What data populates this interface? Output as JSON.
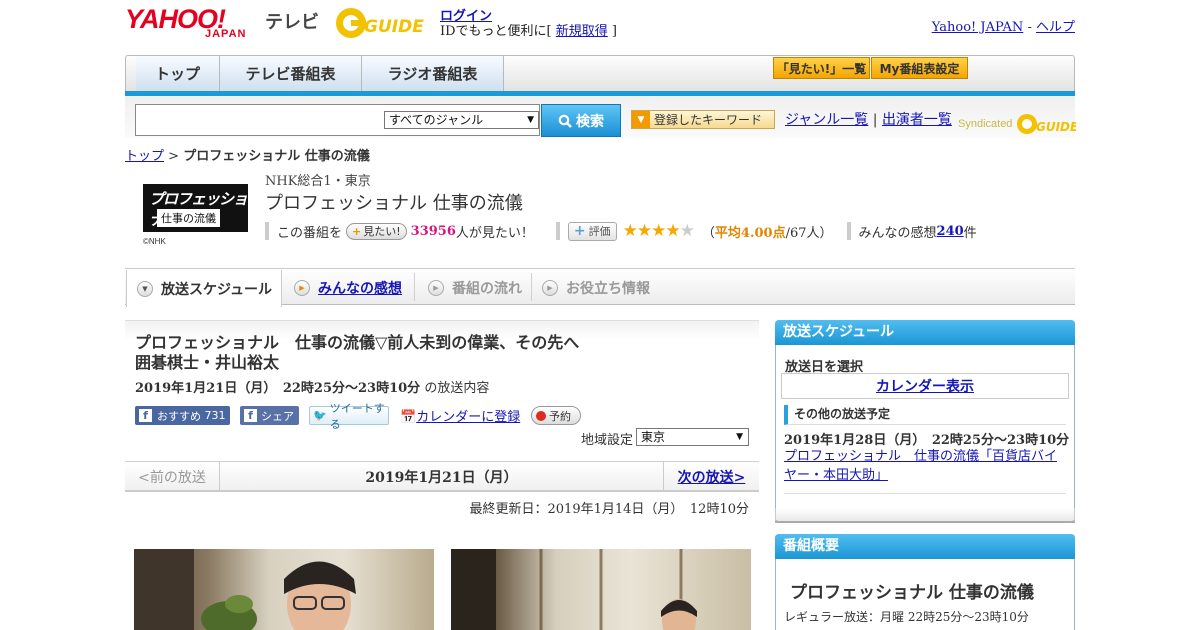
{
  "header": {
    "logo_yahoo": "YAHOO!",
    "logo_japan": "JAPAN",
    "logo_tv": "テレビ",
    "logo_gguide": "GUIDE",
    "login_link": "ログイン",
    "login_prefix": "IDでもっと便利に[ ",
    "register_link": "新規取得",
    "login_suffix": " ]",
    "yahoo_japan_link": "Yahoo! JAPAN",
    "sep": " - ",
    "help_link": "ヘルプ"
  },
  "nav": {
    "tabs": [
      "トップ",
      "テレビ番組表",
      "ラジオ番組表"
    ],
    "want_list": "「見たい!」一覧",
    "my_schedule": "My番組表設定"
  },
  "search": {
    "genre": "すべてのジャンル",
    "button": "検索",
    "keyword_button": "登録したキーワード",
    "genre_list": "ジャンル一覧",
    "divider": " | ",
    "cast_list": "出演者一覧",
    "syndicated": "Syndicated"
  },
  "breadcrumb": {
    "top": "トップ",
    "sep": " > ",
    "current": "プロフェッショナル 仕事の流儀"
  },
  "program": {
    "logo_line1": "プロフェッショナル",
    "logo_line2": "仕事の流儀",
    "logo_credit": "©NHK",
    "channel": "NHK総合1・東京",
    "title": "プロフェッショナル 仕事の流儀",
    "want_prefix": "この番組を",
    "want_button": "見たい!",
    "want_count": "33956",
    "want_suffix": "人が見たい！",
    "eval_button": "評価",
    "rating": 4.0,
    "avg_prefix": "（",
    "avg_text": "平均4.00点",
    "avg_suffix": "/67人）",
    "impressions_label": "みんなの感想 ",
    "impressions_count": "240",
    "impressions_unit": "件"
  },
  "subtabs": [
    "放送スケジュール",
    "みんなの感想",
    "番組の流れ",
    "お役立ち情報"
  ],
  "episode": {
    "title": "プロフェッショナル　仕事の流儀▽前人未到の偉業、その先へ　囲碁棋士・井山裕太",
    "datetime": "2019年1月21日（月）　22時25分～23時10分",
    "datetime_suffix": "の放送内容",
    "fb_like": "おすすめ",
    "fb_like_count": "731",
    "fb_share": "シェア",
    "tweet": "ツイートする",
    "calendar_link": "カレンダーに登録",
    "reserve": "予約",
    "region_label": "地域設定",
    "region_value": "東京"
  },
  "pager": {
    "prev": "<前の放送",
    "date": "2019年1月21日（月）",
    "next": "次の放送>"
  },
  "updated": "最終更新日：2019年1月14日（月）　12時10分",
  "sidebar": {
    "schedule_title": "放送スケジュール",
    "select_date": "放送日を選択",
    "calendar_view": "カレンダー表示",
    "other_title": "その他の放送予定",
    "other_time": "2019年1月28日（月）　22時25分～23時10分",
    "other_link": "プロフェッショナル　仕事の流儀「百貨店バイヤー・本田大助」",
    "summary_title": "番組概要",
    "summary_program": "プロフェッショナル 仕事の流儀",
    "summary_regular": "レギュラー放送：月曜 22時25分～23時10分"
  }
}
